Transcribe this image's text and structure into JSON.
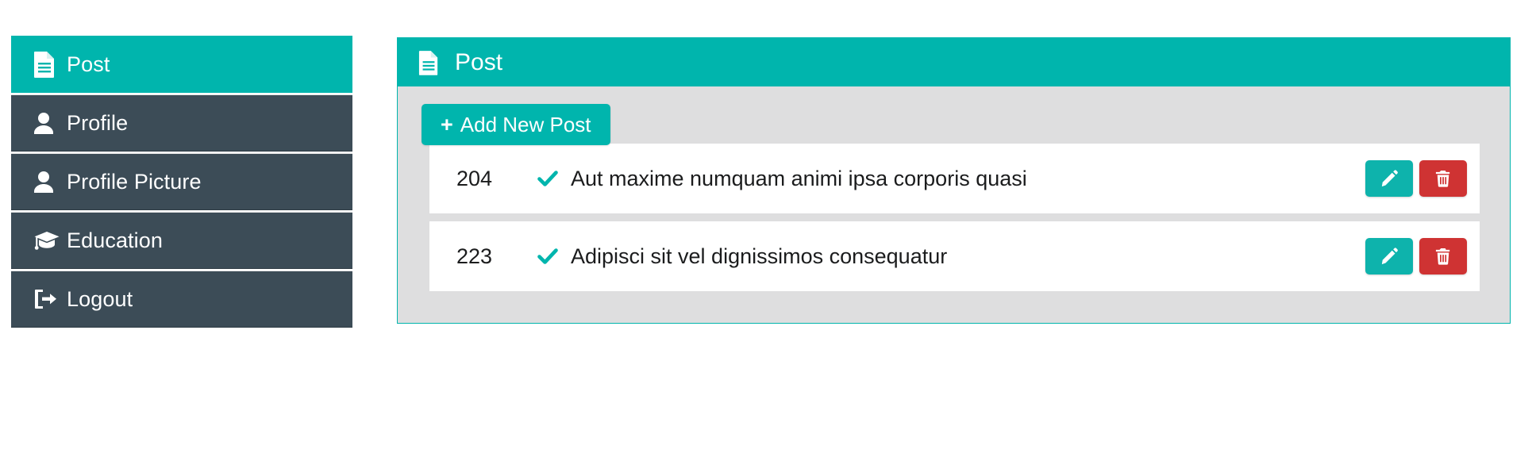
{
  "sidebar": {
    "items": [
      {
        "label": "Post",
        "icon": "file-text-icon",
        "active": true
      },
      {
        "label": "Profile",
        "icon": "user-icon",
        "active": false
      },
      {
        "label": "Profile Picture",
        "icon": "user-icon",
        "active": false
      },
      {
        "label": "Education",
        "icon": "graduation-cap-icon",
        "active": false
      },
      {
        "label": "Logout",
        "icon": "sign-out-icon",
        "active": false
      }
    ]
  },
  "panel": {
    "title": "Post",
    "header_icon": "file-text-icon",
    "add_button": {
      "label": "Add New Post",
      "plus": "+"
    },
    "rows": [
      {
        "id": "204",
        "status_icon": "check-icon",
        "title": "Aut maxime numquam animi ipsa corporis quasi",
        "edit_icon": "pencil-icon",
        "delete_icon": "trash-icon"
      },
      {
        "id": "223",
        "status_icon": "check-icon",
        "title": "Adipisci sit vel dignissimos consequatur",
        "edit_icon": "pencil-icon",
        "delete_icon": "trash-icon"
      }
    ]
  },
  "colors": {
    "teal": "#00b5ad",
    "dark_slate": "#3c4c57",
    "panel_bg": "#dededf",
    "red": "#cf3333",
    "white": "#ffffff"
  }
}
